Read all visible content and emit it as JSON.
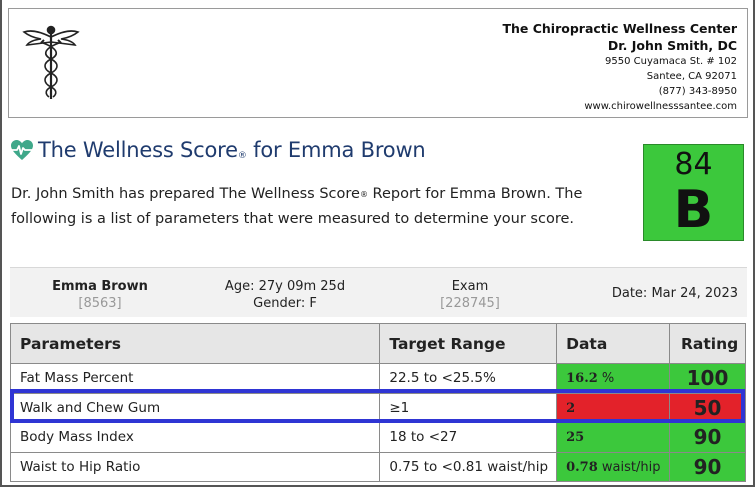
{
  "clinic": {
    "name": "The Chiropractic Wellness Center",
    "doctor": "Dr. John Smith, DC",
    "address1": "9550 Cuyamaca St. # 102",
    "address2": "Santee, CA 92071",
    "phone": "(877) 343-8950",
    "website": "www.chirowellnesssantee.com"
  },
  "report": {
    "title_prefix": "The Wellness Score",
    "title_suffix": " for Emma Brown",
    "registered_mark": "®",
    "intro_part1": "Dr. John Smith has prepared The Wellness Score",
    "intro_part2": " Report for Emma Brown. The following is a list of parameters that were measured to determine your score.",
    "score": "84",
    "grade": "B",
    "score_color": "#3cc83c"
  },
  "patient": {
    "name": "Emma Brown",
    "id": "[8563]",
    "age": "Age: 27y 09m 25d",
    "gender": "Gender: F",
    "exam_label": "Exam",
    "exam_id": "[228745]",
    "date": "Date: Mar 24, 2023"
  },
  "table": {
    "headers": {
      "parameters": "Parameters",
      "target_range": "Target Range",
      "data": "Data",
      "rating": "Rating"
    },
    "rows": [
      {
        "parameter": "Fat Mass Percent",
        "range": "22.5 to <25.5%",
        "value": "16.2",
        "unit": " %",
        "rating": "100",
        "status": "green"
      },
      {
        "parameter": "Walk and Chew Gum",
        "range": "≥1",
        "value": "2",
        "unit": "",
        "rating": "50",
        "status": "red"
      },
      {
        "parameter": "Body Mass Index",
        "range": "18 to <27",
        "value": "25",
        "unit": "",
        "rating": "90",
        "status": "green"
      },
      {
        "parameter": "Waist to Hip Ratio",
        "range": "0.75 to <0.81 waist/hip",
        "value": "0.78",
        "unit": " waist/hip",
        "rating": "90",
        "status": "green"
      }
    ]
  },
  "colors": {
    "good": "#3cc83c",
    "bad": "#e3222a",
    "highlight": "#2f35d4",
    "title": "#1f3b6e"
  },
  "icons": {
    "logo": "caduceus-logo",
    "title_icon": "heartbeat-icon"
  }
}
